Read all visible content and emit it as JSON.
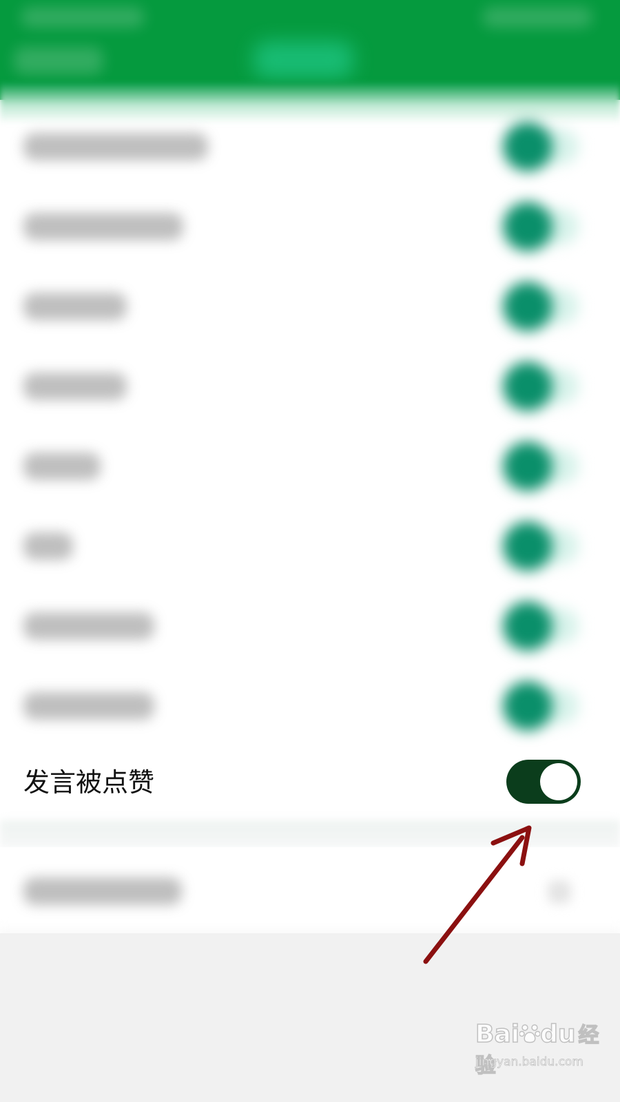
{
  "header": {
    "tabs": [
      "",
      "",
      ""
    ],
    "accent_color": "#059a3e",
    "active_tab_color": "#1cc27d"
  },
  "settings_rows": [
    {
      "label": "",
      "toggle_on": true
    },
    {
      "label": "",
      "toggle_on": true
    },
    {
      "label": "",
      "toggle_on": true
    },
    {
      "label": "",
      "toggle_on": true
    },
    {
      "label": "",
      "toggle_on": true
    },
    {
      "label": "",
      "toggle_on": true
    },
    {
      "label": "",
      "toggle_on": true
    },
    {
      "label": "",
      "toggle_on": true
    }
  ],
  "focused_row": {
    "label": "发言被点赞",
    "toggle_on": true,
    "toggle_color": "#0b3d1c"
  },
  "next_group": {
    "row_label": "",
    "icon": "chevron-right-icon"
  },
  "annotation": {
    "arrow_color": "#8b1010",
    "points_to": "focused-toggle"
  },
  "watermark": {
    "logo_text": "Bai",
    "logo_text_2": "du",
    "logo_text_cn": "经验",
    "site": "jingyan.baidu.com",
    "icon": "paw-icon"
  }
}
